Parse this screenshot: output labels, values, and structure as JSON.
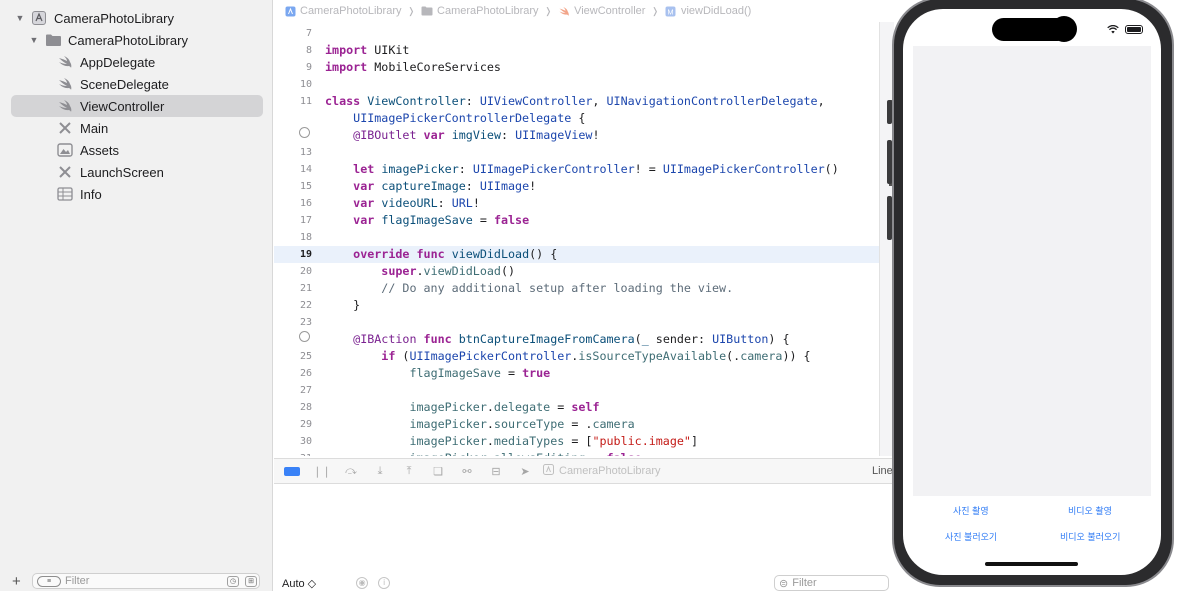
{
  "navigator": {
    "items": [
      {
        "label": "CameraPhotoLibrary",
        "icon": "project-icon",
        "expanded": true
      },
      {
        "label": "CameraPhotoLibrary",
        "icon": "folder-icon",
        "expanded": true
      },
      {
        "label": "AppDelegate",
        "icon": "swift-file-icon"
      },
      {
        "label": "SceneDelegate",
        "icon": "swift-file-icon"
      },
      {
        "label": "ViewController",
        "icon": "swift-file-icon",
        "selected": true
      },
      {
        "label": "Main",
        "icon": "storyboard-icon"
      },
      {
        "label": "Assets",
        "icon": "asset-catalog-icon"
      },
      {
        "label": "LaunchScreen",
        "icon": "storyboard-icon"
      },
      {
        "label": "Info",
        "icon": "plist-icon"
      }
    ],
    "filter_placeholder": "Filter"
  },
  "jumpbar": {
    "items": [
      "CameraPhotoLibrary",
      "CameraPhotoLibrary",
      "ViewController",
      "viewDidLoad()"
    ]
  },
  "editor": {
    "current_line": 19,
    "lines": [
      {
        "n": "7",
        "code": ""
      },
      {
        "n": "8",
        "code": "import UIKit"
      },
      {
        "n": "9",
        "code": "import MobileCoreServices"
      },
      {
        "n": "10",
        "code": ""
      },
      {
        "n": "11",
        "code": "class ViewController: UIViewController, UINavigationControllerDelegate,"
      },
      {
        "n": "",
        "code": "    UIImagePickerControllerDelegate {"
      },
      {
        "n": "",
        "code": "    @IBOutlet var imgView: UIImageView!",
        "connection_dot": true
      },
      {
        "n": "13",
        "code": ""
      },
      {
        "n": "14",
        "code": "    let imagePicker: UIImagePickerController! = UIImagePickerController()"
      },
      {
        "n": "15",
        "code": "    var captureImage: UIImage!"
      },
      {
        "n": "16",
        "code": "    var videoURL: URL!"
      },
      {
        "n": "17",
        "code": "    var flagImageSave = false"
      },
      {
        "n": "18",
        "code": ""
      },
      {
        "n": "19",
        "code": "    override func viewDidLoad() {"
      },
      {
        "n": "20",
        "code": "        super.viewDidLoad()"
      },
      {
        "n": "21",
        "code": "        // Do any additional setup after loading the view."
      },
      {
        "n": "22",
        "code": "    }"
      },
      {
        "n": "23",
        "code": ""
      },
      {
        "n": "",
        "code": "    @IBAction func btnCaptureImageFromCamera(_ sender: UIButton) {",
        "connection_dot": true
      },
      {
        "n": "25",
        "code": "        if (UIImagePickerController.isSourceTypeAvailable(.camera)) {"
      },
      {
        "n": "26",
        "code": "            flagImageSave = true"
      },
      {
        "n": "27",
        "code": ""
      },
      {
        "n": "28",
        "code": "            imagePicker.delegate = self"
      },
      {
        "n": "29",
        "code": "            imagePicker.sourceType = .camera"
      },
      {
        "n": "30",
        "code": "            imagePicker.mediaTypes = [\"public.image\"]"
      },
      {
        "n": "31",
        "code": "            imagePicker.allowsEditing = false"
      }
    ]
  },
  "debugbar": {
    "target": "CameraPhotoLibrary",
    "line_label": "Line"
  },
  "console": {
    "mode": "Auto ◇",
    "filter_placeholder": "Filter"
  },
  "simulator": {
    "buttons": [
      {
        "label": "사진 촬영"
      },
      {
        "label": "비디오 촬영"
      },
      {
        "label": "사진 불러오기"
      },
      {
        "label": "비디오 불러오기"
      }
    ],
    "accent": "#2f7bf5"
  },
  "colors": {
    "keyword": "#9b2393",
    "type": "#1c46ad",
    "string": "#c41a16",
    "comment": "#5d6c79",
    "selection": "#d4d4d6"
  }
}
